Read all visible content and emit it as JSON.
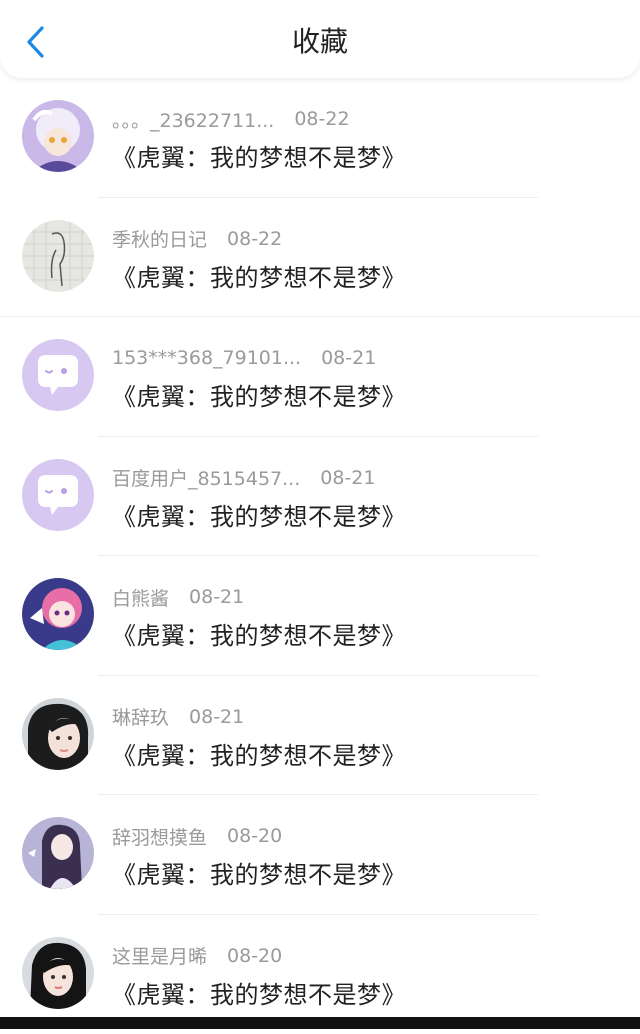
{
  "header": {
    "title": "收藏",
    "back_icon": "chevron-left-icon",
    "accent": "#1e88e5"
  },
  "favorites": [
    {
      "name": "。。。_23622711...",
      "date": "08-22",
      "content": "《虎翼：我的梦想不是梦》",
      "avatar": "anime-white-hair"
    },
    {
      "name": "季秋的日记",
      "date": "08-22",
      "content": "《虎翼：我的梦想不是梦》",
      "avatar": "sketch"
    },
    {
      "name": "153***368_79101...",
      "date": "08-21",
      "content": "《虎翼：我的梦想不是梦》",
      "avatar": "default-chat"
    },
    {
      "name": "百度用户_8515457...",
      "date": "08-21",
      "content": "《虎翼：我的梦想不是梦》",
      "avatar": "default-chat"
    },
    {
      "name": "白熊酱",
      "date": "08-21",
      "content": "《虎翼：我的梦想不是梦》",
      "avatar": "anime-pink"
    },
    {
      "name": "琳辞玖",
      "date": "08-21",
      "content": "《虎翼：我的梦想不是梦》",
      "avatar": "photo-girl"
    },
    {
      "name": "辞羽想摸鱼",
      "date": "08-20",
      "content": "《虎翼：我的梦想不是梦》",
      "avatar": "anime-dark-hair"
    },
    {
      "name": "这里是月晞",
      "date": "08-20",
      "content": "《虎翼：我的梦想不是梦》",
      "avatar": "photo-girl-2"
    }
  ]
}
